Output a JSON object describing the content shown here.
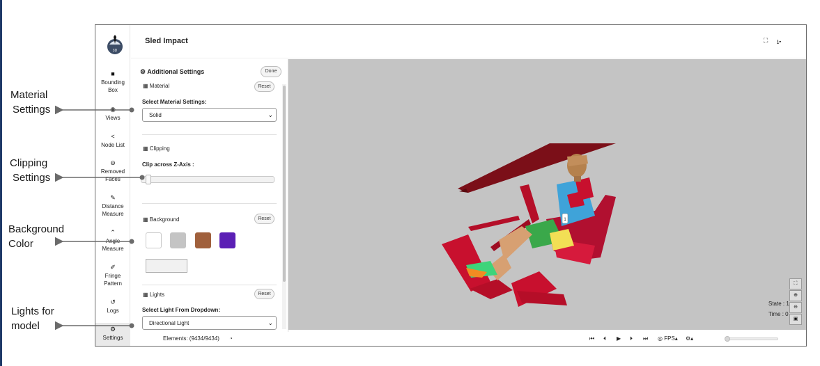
{
  "callouts": [
    {
      "line1": "Material",
      "line2": "Settings"
    },
    {
      "line1": "Clipping",
      "line2": "Settings"
    },
    {
      "line1": "Background",
      "line2": "Color"
    },
    {
      "line1": "Lights for",
      "line2": "model"
    }
  ],
  "app": {
    "logo_label": "3D",
    "title": "Sled Impact",
    "header_icons": [
      "fullscreen-icon",
      "download-icon"
    ]
  },
  "nav": [
    {
      "name": "bounding-box",
      "line1": "Bounding",
      "line2": "Box",
      "icon": "cube-icon"
    },
    {
      "name": "views",
      "line1": "Views",
      "line2": "",
      "icon": "eye-icon"
    },
    {
      "name": "node-list",
      "line1": "Node List",
      "line2": "",
      "icon": "share-icon"
    },
    {
      "name": "removed-faces",
      "line1": "Removed",
      "line2": "Faces",
      "icon": "minus-circle-icon"
    },
    {
      "name": "distance-measure",
      "line1": "Distance",
      "line2": "Measure",
      "icon": "ruler-icon"
    },
    {
      "name": "angle-measure",
      "line1": "Angle",
      "line2": "Measure",
      "icon": "angle-up-icon"
    },
    {
      "name": "fringe-pattern",
      "line1": "Fringe",
      "line2": "Pattern",
      "icon": "brush-icon"
    },
    {
      "name": "logs",
      "line1": "Logs",
      "line2": "",
      "icon": "history-icon"
    },
    {
      "name": "settings",
      "line1": "Settings",
      "line2": "",
      "icon": "gear-icon"
    }
  ],
  "panel": {
    "title": "Additional Settings",
    "done": "Done",
    "material": {
      "title": "Material",
      "reset": "Reset",
      "label": "Select Material Settings:",
      "value": "Solid"
    },
    "clipping": {
      "title": "Clipping",
      "label": "Clip across Z-Axis :",
      "value_fraction": 0.02
    },
    "background": {
      "title": "Background",
      "reset": "Reset",
      "swatches": [
        "#ffffff",
        "#c4c4c4",
        "#a0603c",
        "#5b1fb5"
      ],
      "custom_color": "#f1f1f1"
    },
    "lights": {
      "title": "Lights",
      "reset": "Reset",
      "label": "Select Light From Dropdown:",
      "value": "Directional Light"
    }
  },
  "viewport": {
    "background": "#c4c4c4",
    "marker": "1",
    "state": "State : 1",
    "time": "Time : 0",
    "tools": [
      "fit-icon",
      "zoom-in-icon",
      "zoom-out-icon",
      "camera-icon"
    ]
  },
  "footer": {
    "elements": "Elements: (9434/9434)",
    "fps": "FPS",
    "playback": [
      "first-frame-icon",
      "prev-frame-icon",
      "play-icon",
      "next-frame-icon",
      "last-frame-icon"
    ],
    "progress_fraction": 0.0
  }
}
